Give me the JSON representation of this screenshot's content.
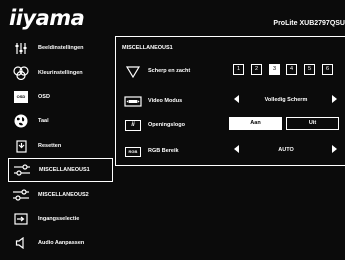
{
  "header": {
    "logo": "iiyama",
    "model": "ProLite XUB2797QSU"
  },
  "sidebar": {
    "items": [
      {
        "label": "Beeldinstellingen",
        "icon": "display-settings-icon"
      },
      {
        "label": "Kleurinstellingen",
        "icon": "color-settings-icon"
      },
      {
        "label": "OSD",
        "icon": "osd-icon",
        "icon_text": "OSD"
      },
      {
        "label": "Taal",
        "icon": "globe-icon"
      },
      {
        "label": "Resetten",
        "icon": "reset-icon"
      },
      {
        "label": "MISCELLANEOUS1",
        "icon": "sliders-icon",
        "active": true
      },
      {
        "label": "MISCELLANEOUS2",
        "icon": "sliders-icon"
      },
      {
        "label": "Ingangsselectie",
        "icon": "input-select-icon"
      },
      {
        "label": "Audio Aanpassen",
        "icon": "speaker-icon"
      }
    ]
  },
  "panel": {
    "title": "MISCELLANEOUS1",
    "sharpness": {
      "label": "Scherp en zacht",
      "options": [
        "1",
        "2",
        "3",
        "4",
        "5",
        "6"
      ],
      "selected": "3"
    },
    "video_mode": {
      "label": "Video Modus",
      "value": "Volledig Scherm"
    },
    "opening_logo": {
      "label": "Openingslogo",
      "options": [
        "Aan",
        "Uit"
      ],
      "selected": "Aan",
      "icon_text": "ii"
    },
    "rgb_range": {
      "label": "RGB Bereik",
      "value": "AUTO",
      "icon_text": "RGB"
    }
  }
}
